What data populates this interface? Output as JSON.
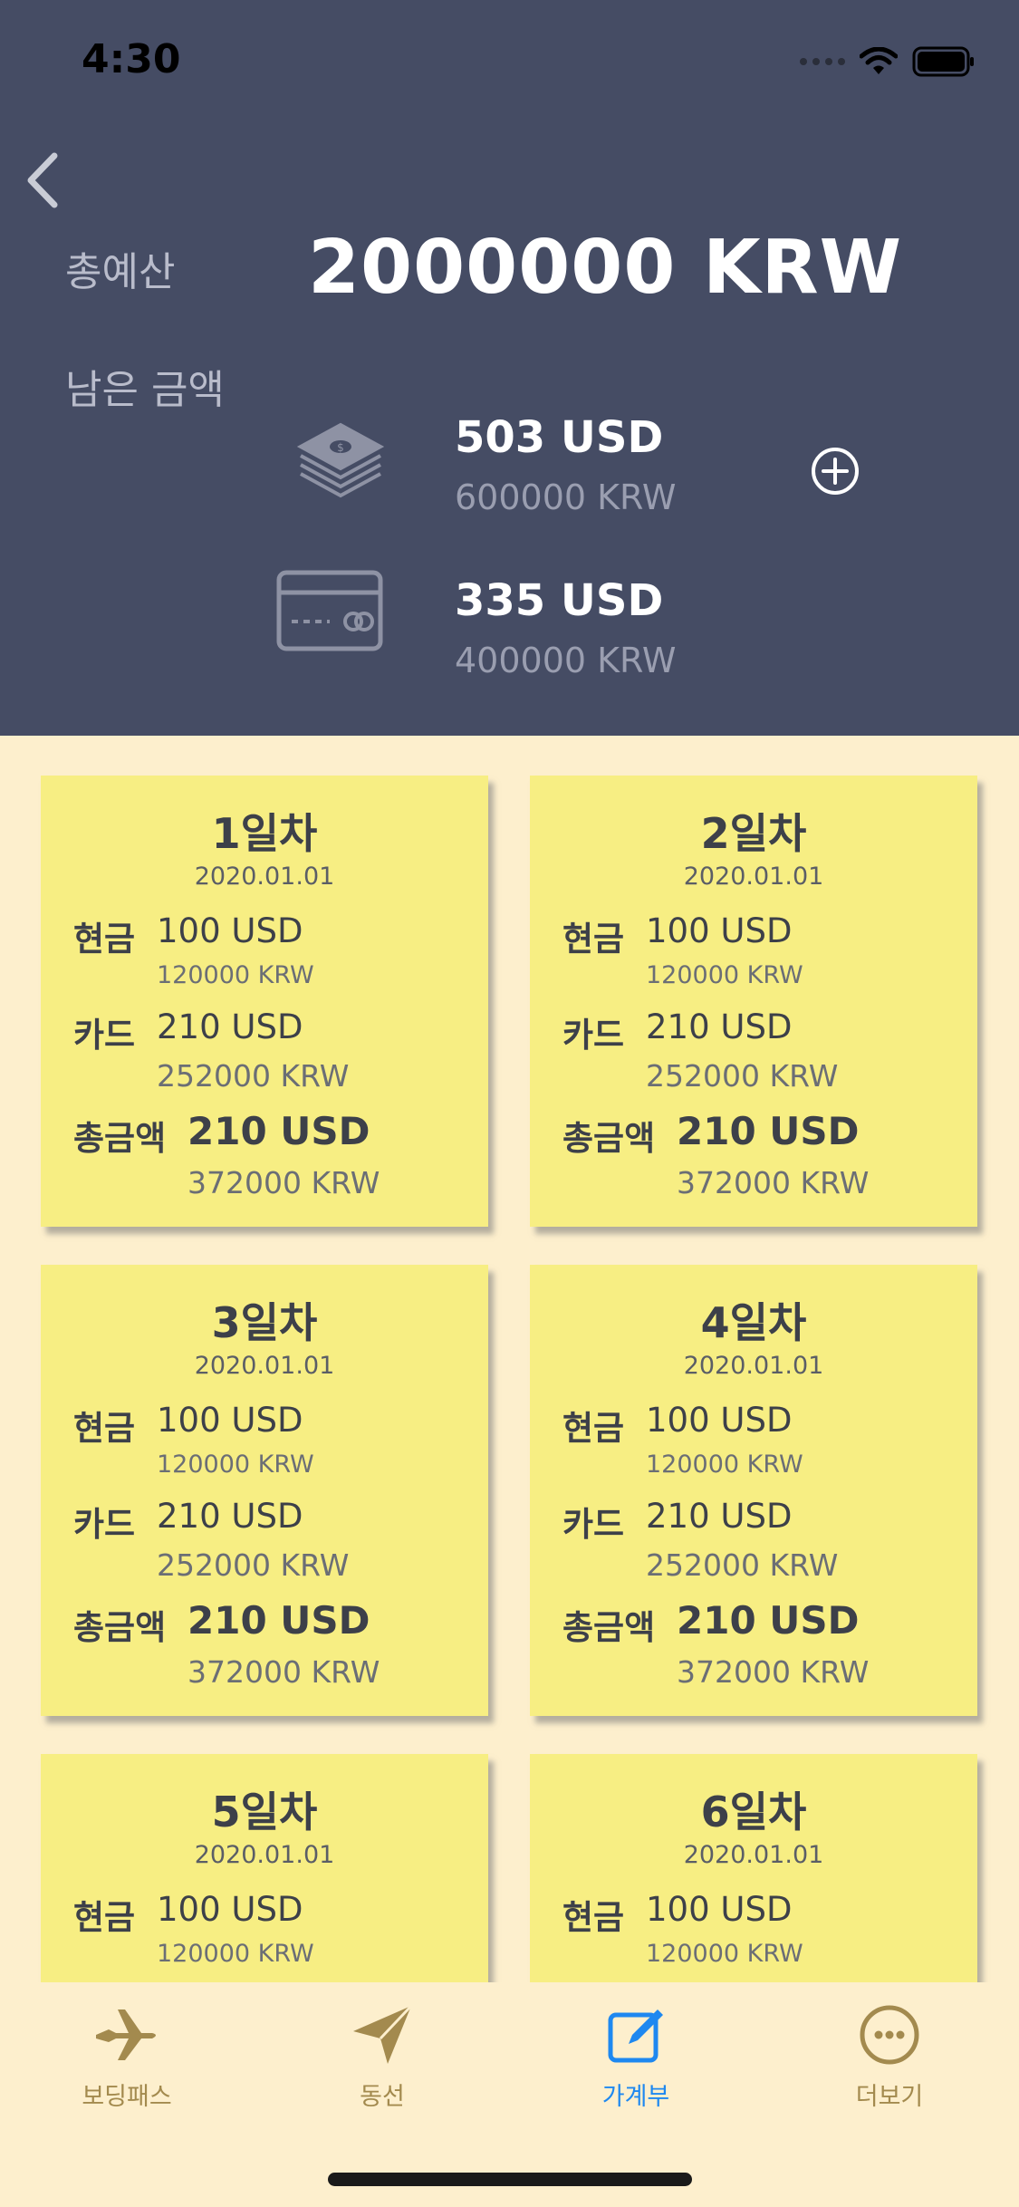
{
  "status_bar": {
    "time": "4:30"
  },
  "header": {
    "total_label": "총예산",
    "total_amount": "2000000 KRW",
    "remaining_label": "남은 금액",
    "cash": {
      "usd": "503 USD",
      "krw": "600000 KRW"
    },
    "card": {
      "usd": "335 USD",
      "krw": "400000 KRW"
    }
  },
  "cards": [
    {
      "day": "1일차",
      "date": "2020.01.01",
      "cash_label": "현금",
      "cash_usd": "100 USD",
      "cash_krw": "120000 KRW",
      "card_label": "카드",
      "card_usd": "210 USD",
      "card_krw": "252000 KRW",
      "total_label": "총금액",
      "total_usd": "210 USD",
      "total_krw": "372000 KRW"
    },
    {
      "day": "2일차",
      "date": "2020.01.01",
      "cash_label": "현금",
      "cash_usd": "100 USD",
      "cash_krw": "120000 KRW",
      "card_label": "카드",
      "card_usd": "210 USD",
      "card_krw": "252000 KRW",
      "total_label": "총금액",
      "total_usd": "210 USD",
      "total_krw": "372000 KRW"
    },
    {
      "day": "3일차",
      "date": "2020.01.01",
      "cash_label": "현금",
      "cash_usd": "100 USD",
      "cash_krw": "120000 KRW",
      "card_label": "카드",
      "card_usd": "210 USD",
      "card_krw": "252000 KRW",
      "total_label": "총금액",
      "total_usd": "210 USD",
      "total_krw": "372000 KRW"
    },
    {
      "day": "4일차",
      "date": "2020.01.01",
      "cash_label": "현금",
      "cash_usd": "100 USD",
      "cash_krw": "120000 KRW",
      "card_label": "카드",
      "card_usd": "210 USD",
      "card_krw": "252000 KRW",
      "total_label": "총금액",
      "total_usd": "210 USD",
      "total_krw": "372000 KRW"
    },
    {
      "day": "5일차",
      "date": "2020.01.01",
      "cash_label": "현금",
      "cash_usd": "100 USD",
      "cash_krw": "120000 KRW"
    },
    {
      "day": "6일차",
      "date": "2020.01.01",
      "cash_label": "현금",
      "cash_usd": "100 USD",
      "cash_krw": "120000 KRW"
    }
  ],
  "tabbar": {
    "items": [
      {
        "label": "보딩패스",
        "icon": "airplane-icon"
      },
      {
        "label": "동선",
        "icon": "paper-plane-icon"
      },
      {
        "label": "가계부",
        "icon": "edit-square-icon",
        "selected": true
      },
      {
        "label": "더보기",
        "icon": "more-circle-icon"
      }
    ]
  },
  "colors": {
    "header_bg": "#454c64",
    "page_bg": "#fdefcd",
    "note_bg": "#f7ee83",
    "tab_inactive": "#a38a4e",
    "tab_active": "#1e88f0"
  }
}
